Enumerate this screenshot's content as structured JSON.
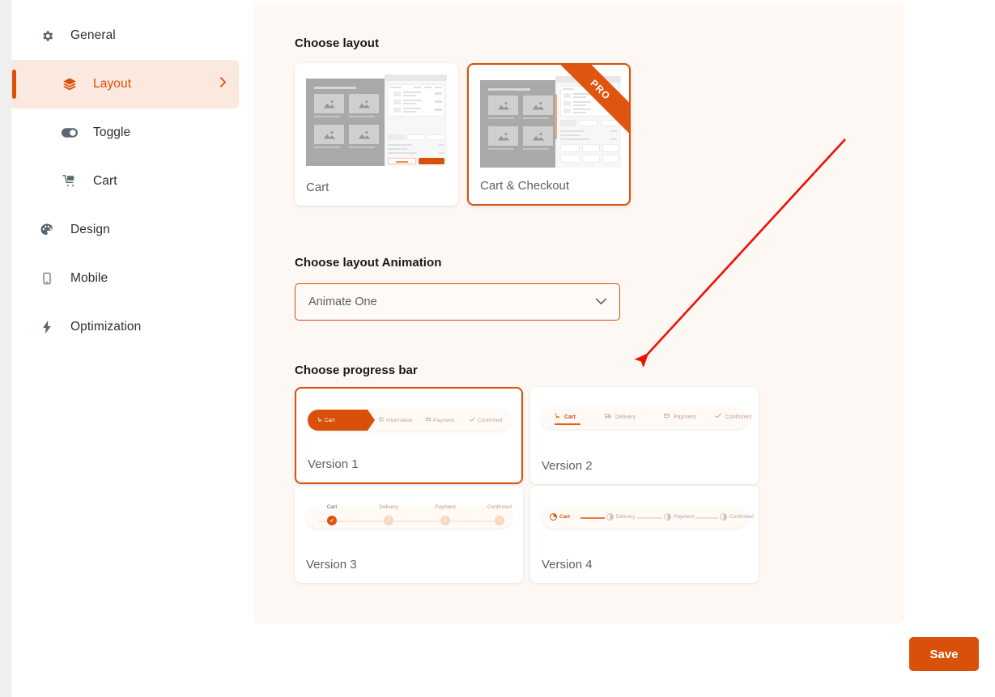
{
  "sidebar": {
    "items": [
      {
        "label": "General",
        "icon": "gear-icon",
        "level": 1,
        "active": false
      },
      {
        "label": "Layout",
        "icon": "layers-icon",
        "level": 2,
        "active": true
      },
      {
        "label": "Toggle",
        "icon": "toggle-icon",
        "level": 2,
        "active": false
      },
      {
        "label": "Cart",
        "icon": "cart-icon",
        "level": 2,
        "active": false
      },
      {
        "label": "Design",
        "icon": "palette-icon",
        "level": 1,
        "active": false
      },
      {
        "label": "Mobile",
        "icon": "mobile-icon",
        "level": 1,
        "active": false
      },
      {
        "label": "Optimization",
        "icon": "lightning-icon",
        "level": 1,
        "active": false
      }
    ]
  },
  "main": {
    "layout_section": {
      "title": "Choose layout",
      "options": [
        {
          "label": "Cart",
          "selected": false,
          "badge": ""
        },
        {
          "label": "Cart & Checkout",
          "selected": true,
          "badge": "PRO"
        }
      ]
    },
    "animation_section": {
      "title": "Choose layout Animation",
      "selected": "Animate One",
      "chevron": "chevron-down-icon"
    },
    "progress_section": {
      "title": "Choose progress bar",
      "options": [
        {
          "label": "Version 1",
          "selected": true,
          "steps": [
            {
              "text": "Cart",
              "glyph": "Ὥ2",
              "active": true
            },
            {
              "text": "Information",
              "glyph": "info",
              "active": false
            },
            {
              "text": "Payment",
              "glyph": "card",
              "active": false
            },
            {
              "text": "Confirmed",
              "glyph": "check",
              "active": false
            }
          ]
        },
        {
          "label": "Version 2",
          "selected": false,
          "steps": [
            {
              "text": "Cart",
              "glyph": "cart",
              "active": true
            },
            {
              "text": "Delivery",
              "glyph": "truck",
              "active": false
            },
            {
              "text": "Payment",
              "glyph": "card",
              "active": false
            },
            {
              "text": "Confirmed",
              "glyph": "check",
              "active": false
            }
          ]
        },
        {
          "label": "Version 3",
          "selected": false,
          "steps": [
            {
              "text": "Cart",
              "num": "✔",
              "active": true
            },
            {
              "text": "Delivery",
              "num": "2",
              "active": false
            },
            {
              "text": "Payment",
              "num": "3",
              "active": false
            },
            {
              "text": "Confirmed",
              "num": "4",
              "active": false
            }
          ]
        },
        {
          "label": "Version 4",
          "selected": false,
          "steps": [
            {
              "text": "Cart",
              "active": true
            },
            {
              "text": "Delivery",
              "active": false
            },
            {
              "text": "Payment",
              "active": false
            },
            {
              "text": "Confirmed",
              "active": false
            }
          ]
        }
      ]
    }
  },
  "footer": {
    "save_label": "Save"
  },
  "annotation": {
    "arrow_color": "#f01000"
  },
  "colors": {
    "accent": "#d9500a",
    "accent_soft": "#fbe9df",
    "panel_bg": "#fdf8f4",
    "sidebar_bg": "#ffffff",
    "gutter": "#efeff0",
    "text": "#2b2f33",
    "muted": "#5c6166"
  }
}
